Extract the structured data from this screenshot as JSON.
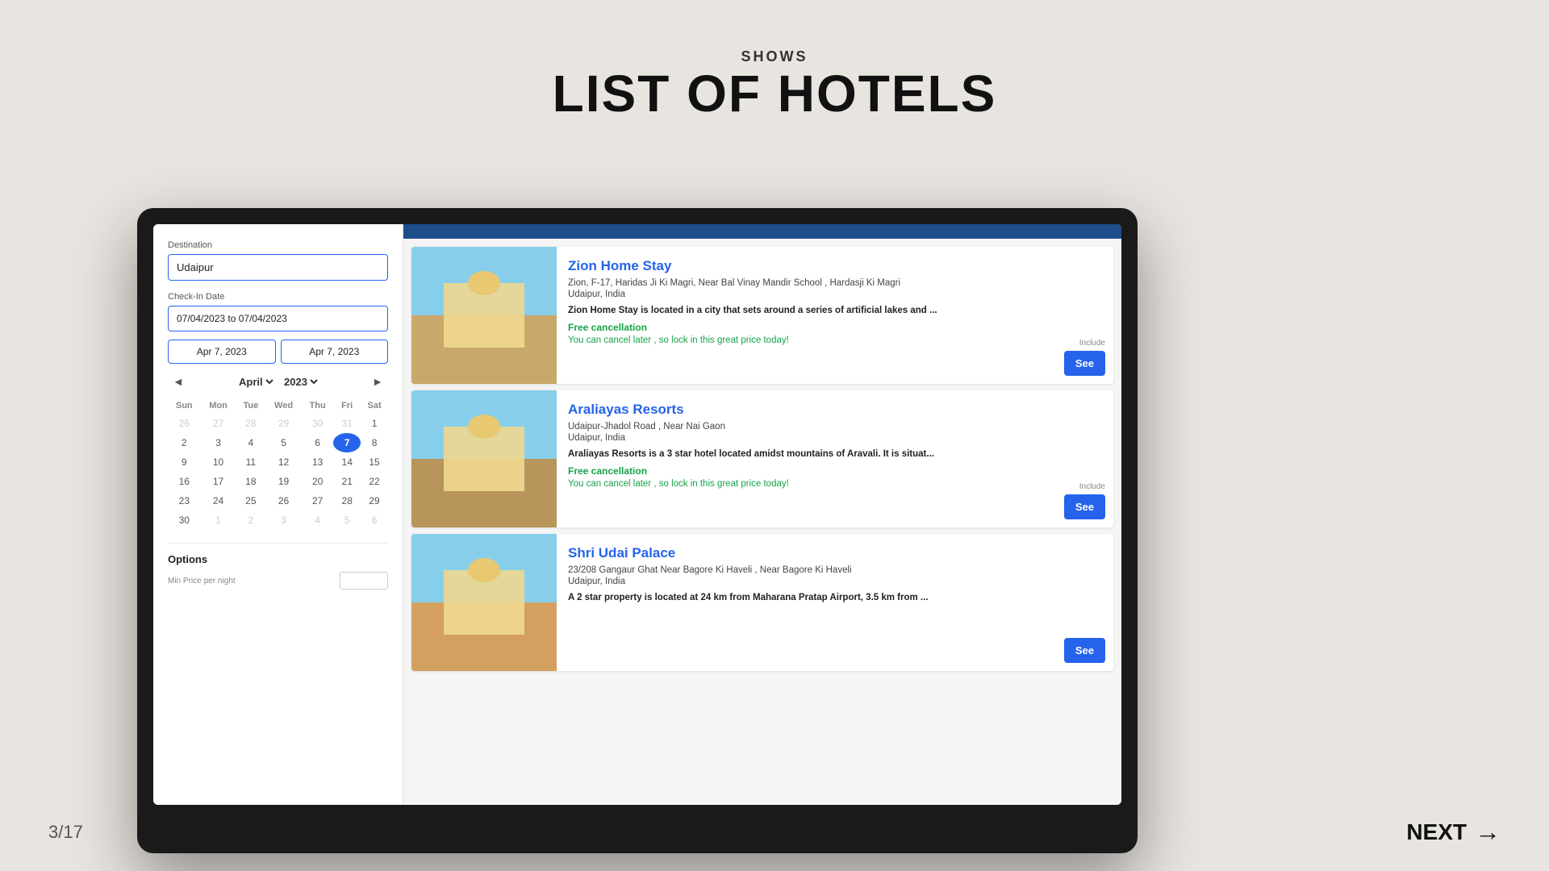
{
  "header": {
    "shows_label": "SHOWS",
    "page_title": "LIST OF HOTELS"
  },
  "left_panel": {
    "destination_label": "Destination",
    "destination_value": "Udaipur",
    "checkin_label": "Check-In Date",
    "date_range": "07/04/2023 to 07/04/2023",
    "date_from": "Apr 7, 2023",
    "date_to": "Apr 7, 2023",
    "calendar": {
      "month": "April",
      "year": "2023",
      "days_header": [
        "Sun",
        "Mon",
        "Tue",
        "Wed",
        "Thu",
        "Fri",
        "Sat"
      ],
      "weeks": [
        [
          "26",
          "27",
          "28",
          "29",
          "30",
          "31",
          "1"
        ],
        [
          "2",
          "3",
          "4",
          "5",
          "6",
          "7",
          "8"
        ],
        [
          "9",
          "10",
          "11",
          "12",
          "13",
          "14",
          "15"
        ],
        [
          "16",
          "17",
          "18",
          "19",
          "20",
          "21",
          "22"
        ],
        [
          "23",
          "24",
          "25",
          "26",
          "27",
          "28",
          "29"
        ],
        [
          "30",
          "1",
          "2",
          "3",
          "4",
          "5",
          "6"
        ]
      ],
      "selected_day": "7",
      "selected_week": 1,
      "selected_col": 5
    },
    "options_title": "Options",
    "min_price_label": "Min Price",
    "min_price_sublabel": "per night"
  },
  "hotels": [
    {
      "name": "Zion Home Stay",
      "address": "Zion, F-17, Haridas Ji Ki Magri, Near Bal Vinay Mandir School , Hardasji Ki Magri",
      "city": "Udaipur, India",
      "description": "Zion Home Stay is located in a city that sets around a series of artificial lakes and ...",
      "free_cancel": "Free cancellation",
      "cancel_note": "You can cancel later , so lock in this great price today!",
      "includes": "Include",
      "see_label": "See"
    },
    {
      "name": "Araliayas Resorts",
      "address": "Udaipur-Jhadol Road , Near Nai Gaon",
      "city": "Udaipur, India",
      "description": "Araliayas Resorts is a 3 star hotel located amidst mountains of Aravali. It is situat...",
      "free_cancel": "Free cancellation",
      "cancel_note": "You can cancel later , so lock in this great price today!",
      "includes": "Include",
      "see_label": "See"
    },
    {
      "name": "Shri Udai Palace",
      "address": "23/208 Gangaur Ghat Near Bagore Ki Haveli , Near Bagore Ki Haveli",
      "city": "Udaipur, India",
      "description": "A 2 star property is located at 24 km from Maharana Pratap Airport, 3.5 km from ...",
      "free_cancel": "",
      "cancel_note": "",
      "includes": "",
      "see_label": "See"
    }
  ],
  "bottom_nav": {
    "page_indicator": "3/17",
    "next_label": "NEXT",
    "next_arrow": "→"
  }
}
